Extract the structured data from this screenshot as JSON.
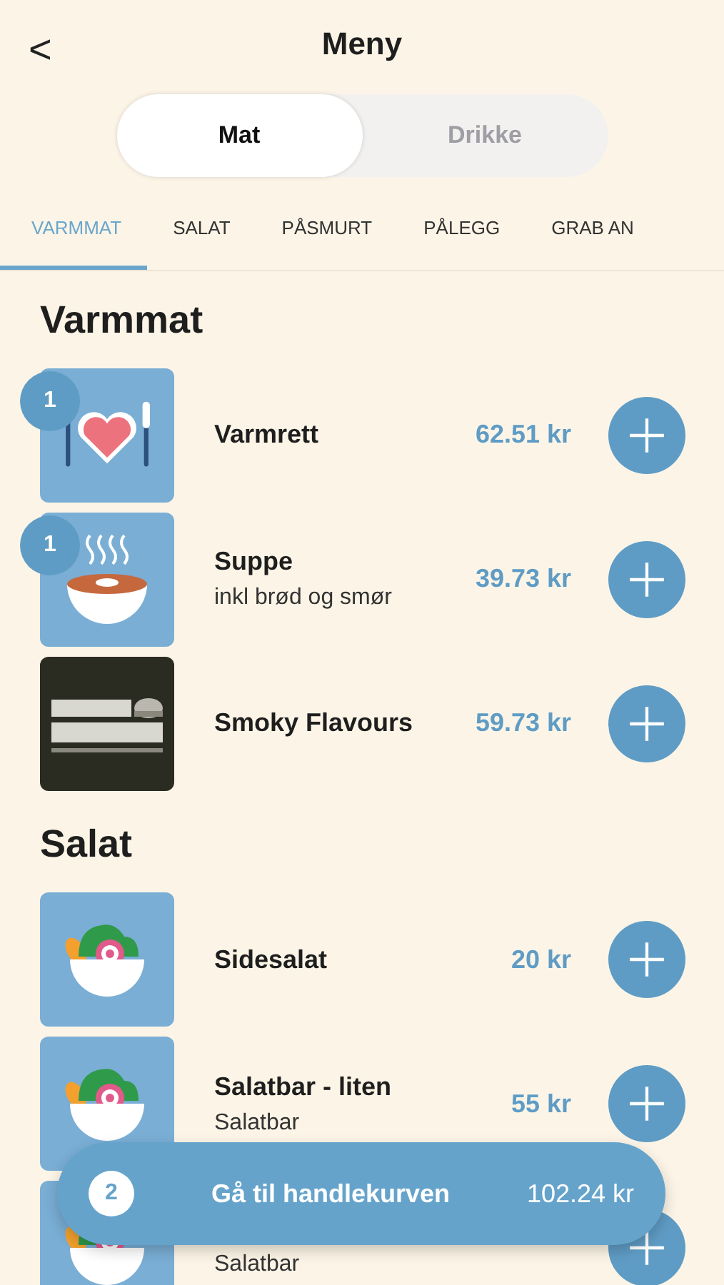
{
  "header": {
    "back": "<",
    "title": "Meny"
  },
  "segments": [
    {
      "label": "Mat",
      "selected": true
    },
    {
      "label": "Drikke",
      "selected": false
    }
  ],
  "category_tabs": [
    {
      "label": "VARMMAT",
      "selected": true
    },
    {
      "label": "SALAT",
      "selected": false
    },
    {
      "label": "PÅSMURT",
      "selected": false
    },
    {
      "label": "PÅLEGG",
      "selected": false
    },
    {
      "label": "GRAB AN",
      "selected": false
    }
  ],
  "sections": [
    {
      "title": "Varmmat",
      "items": [
        {
          "kind": "heart",
          "count": "1",
          "name": "Varmrett",
          "price": "62.51 kr"
        },
        {
          "kind": "soup",
          "count": "1",
          "name": "Suppe",
          "subtitle": "inkl brød og smør",
          "price": "39.73 kr"
        },
        {
          "kind": "picture",
          "name": "Smoky Flavours",
          "price": "59.73 kr"
        }
      ]
    },
    {
      "title": "Salat",
      "items": [
        {
          "kind": "salad",
          "name": "Sidesalat",
          "price": "20 kr"
        },
        {
          "kind": "salad",
          "name": "Salatbar - liten",
          "subtitle": "Salatbar",
          "price": "55 kr"
        },
        {
          "kind": "salad",
          "subtitle": "Salatbar"
        }
      ]
    }
  ],
  "cart_bar": {
    "count": "2",
    "label": "Gå til handlekurven",
    "total": "102.24 kr"
  }
}
